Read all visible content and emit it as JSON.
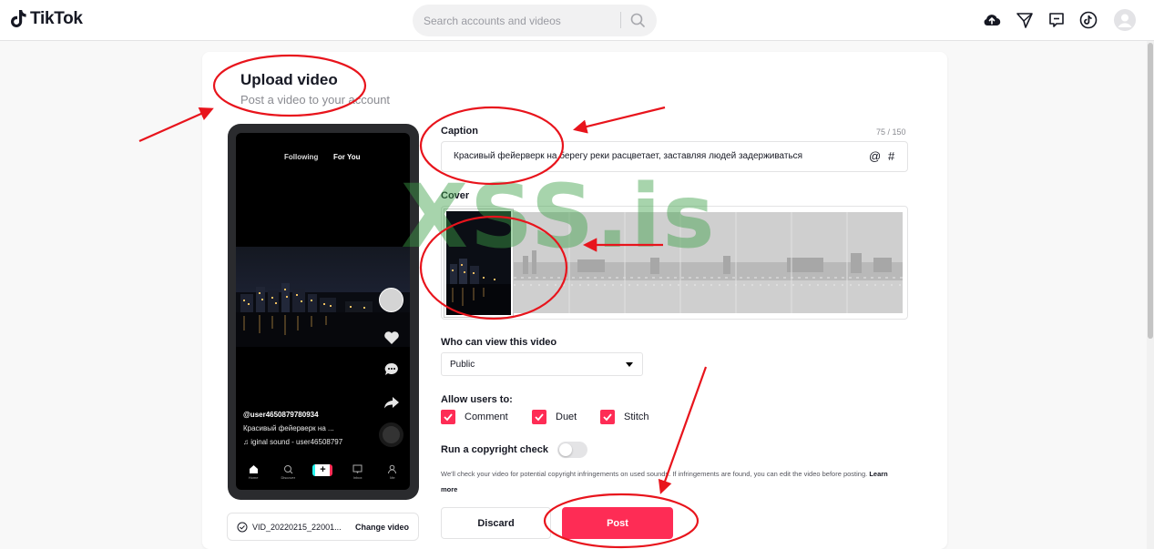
{
  "brand": {
    "name": "TikTok"
  },
  "search": {
    "placeholder": "Search accounts and videos"
  },
  "header_icons": [
    "upload-cloud-icon",
    "inbox-send-icon",
    "messages-icon",
    "tiktok-coin-icon",
    "avatar-icon"
  ],
  "page": {
    "title": "Upload video",
    "subtitle": "Post a video to your account"
  },
  "preview": {
    "tab_following": "Following",
    "tab_for_you": "For You",
    "username": "@user4650879780934",
    "caption": "Красивый фейерверк на ...",
    "sound": "iginal sound - user46508797",
    "nav": [
      "Home",
      "Discover",
      "",
      "Inbox",
      "Me"
    ]
  },
  "file": {
    "name": "VID_20220215_22001...",
    "change_label": "Change video"
  },
  "caption": {
    "label": "Caption",
    "counter": "75 / 150",
    "value": "Красивый фейерверк на берегу реки расцветает, заставляя людей задерживаться",
    "mention": "@",
    "hashtag": "#"
  },
  "cover": {
    "label": "Cover"
  },
  "privacy": {
    "label": "Who can view this video",
    "selected": "Public"
  },
  "allow": {
    "label": "Allow users to:",
    "options": [
      {
        "label": "Comment",
        "checked": true
      },
      {
        "label": "Duet",
        "checked": true
      },
      {
        "label": "Stitch",
        "checked": true
      }
    ]
  },
  "copyright": {
    "label": "Run a copyright check",
    "enabled": false,
    "note_part1": "We'll check your video for potential copyright infringements on used sounds. If infringements are found, you can edit the video before posting.",
    "note_link": "Learn more"
  },
  "actions": {
    "discard": "Discard",
    "post": "Post"
  },
  "watermark": "XSS.is",
  "colors": {
    "accent": "#fe2c55",
    "annotation": "#e8141c",
    "watermark": "#3ca046"
  }
}
